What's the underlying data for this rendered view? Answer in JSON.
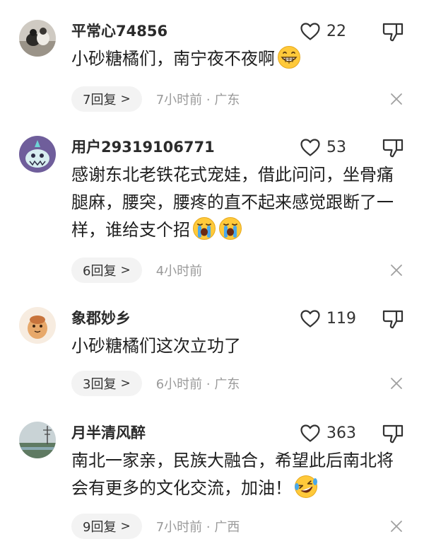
{
  "comments": [
    {
      "username": "平常心74856",
      "likes": "22",
      "text": "小砂糖橘们，南宁夜不夜啊",
      "emojis": [
        "grinning-face"
      ],
      "replies": "7回复",
      "time": "7小时前 · 广东"
    },
    {
      "username": "用户29319106771",
      "likes": "53",
      "text": "感谢东北老铁花式宠娃，借此问问，坐骨痛腿麻，腰突，腰疼的直不起来感觉跟断了一样，谁给支个招",
      "emojis": [
        "loudly-crying-face",
        "loudly-crying-face"
      ],
      "replies": "6回复",
      "time": "4小时前"
    },
    {
      "username": "象郡妙乡",
      "likes": "119",
      "text": "小砂糖橘们这次立功了",
      "emojis": [],
      "replies": "3回复",
      "time": "6小时前 · 广东"
    },
    {
      "username": "月半清风醉",
      "likes": "363",
      "text": "南北一家亲，民族大融合，希望此后南北将会有更多的文化交流，加油！",
      "emojis": [
        "laughing-crying-face"
      ],
      "replies": "9回复",
      "time": "7小时前 · 广西"
    }
  ],
  "icons": {
    "like": "heart-outline-icon",
    "dislike": "thumbs-down-icon",
    "close": "close-icon",
    "chevron": "chevron-right-icon"
  },
  "colors": {
    "text": "#1f1f1f",
    "muted": "#9a9a9a",
    "pill_bg": "#f3f3f3",
    "emoji_yellow": "#ffc93a"
  }
}
